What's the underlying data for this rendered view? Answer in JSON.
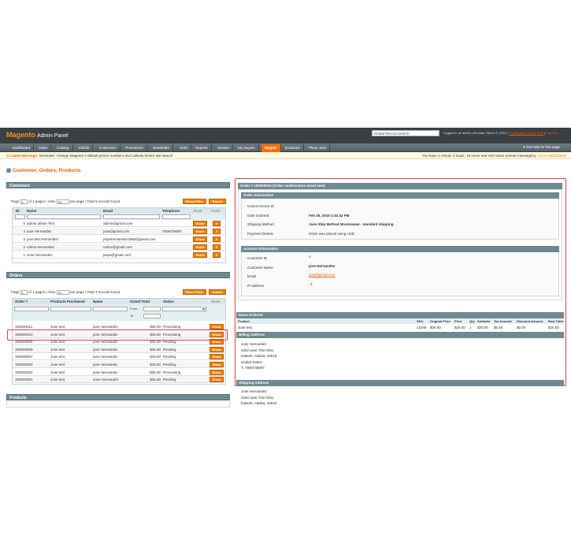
{
  "header": {
    "logo_brand": "Magento",
    "logo_text": "Admin Panel",
    "global_search_value": "Global Record Search",
    "user_info": "Logged in as admin  |  Monday, March 9, 2015  |",
    "try_link": "Try Magento Go for Free",
    "logout": "Log Out"
  },
  "nav": {
    "items": [
      "Dashboard",
      "Sales",
      "Catalog",
      "Mobile",
      "Customers",
      "Promotions",
      "Newsletter",
      "CMS",
      "Reports",
      "System",
      "My plugins",
      "Magebi",
      "Evaluator",
      "Pluya Java"
    ],
    "help": "Get help for this page"
  },
  "message": {
    "label": "Latest Message:",
    "text": "Reminder: Change Magento`s default phone numbers and callouts before site launch",
    "right": "You have 1 critical, 0 major, 18 minor and 160 notice unread message(s).",
    "link": "Go to notifications"
  },
  "page_title": "Customer, Orders, Products",
  "customers": {
    "title": "Customers",
    "pager": {
      "page_label": "Page",
      "page_value": "1",
      "of_pages": "of 1 pages  |  View",
      "per_page_value": "20",
      "per_page_label": "per page  |  Total 5 records found"
    },
    "reset": "Reset Filter",
    "search": "Search",
    "columns": [
      "ID",
      "Name",
      "Email",
      "Telephone",
      "Show",
      "Order"
    ],
    "rows": [
      {
        "id": "5",
        "name": "admin admin Test",
        "email": "admin@gmail.com",
        "tel": "",
        "show": "Show",
        "order": "0"
      },
      {
        "id": "4",
        "name": "jose Hernandez",
        "email": "jose@gmail.com",
        "tel": "7808736697",
        "show": "Show",
        "order": "7"
      },
      {
        "id": "3",
        "name": "jose test Hernandez",
        "email": "pepehernandez1980@gmail.com",
        "tel": "",
        "show": "Show",
        "order": "0"
      },
      {
        "id": "2",
        "name": "carlos Hernandez",
        "email": "carlos@gmail.com",
        "tel": "",
        "show": "Show",
        "order": "0"
      },
      {
        "id": "1",
        "name": "Jose Hernandez",
        "email": "pepe@gmail.com",
        "tel": "",
        "show": "Show",
        "order": "0"
      }
    ]
  },
  "orders": {
    "title": "Orders",
    "pager": {
      "page_label": "Page",
      "page_value": "1",
      "of_pages": "of 1 pages  |  View",
      "per_page_value": "20",
      "per_page_label": "per page  |  Total 7 records found"
    },
    "reset": "Reset Filter",
    "search": "Search",
    "columns": [
      "Order #",
      "Products Purchased",
      "Name",
      "Grand Total",
      "Status",
      "Show"
    ],
    "from_label": "From:",
    "to_label": "To :",
    "rows": [
      {
        "num": "100000011",
        "prod": "Jose test",
        "name": "jose Hernandez",
        "total": "$30.00",
        "status": "Processing",
        "show": "Show"
      },
      {
        "num": "100000010",
        "prod": "Jose test",
        "name": "jose Hernandez",
        "total": "$45.00",
        "status": "Processing",
        "show": "Show"
      },
      {
        "num": "100000008",
        "prod": "Jose test",
        "name": "jose Hernandez",
        "total": "$45.00",
        "status": "Pending",
        "show": "Show"
      },
      {
        "num": "100000009",
        "prod": "Jose test",
        "name": "jose Hernandez",
        "total": "$45.00",
        "status": "Pending",
        "show": "Show"
      },
      {
        "num": "100000007",
        "prod": "Jose test",
        "name": "jose Hernandez",
        "total": "$45.00",
        "status": "Pending",
        "show": "Show"
      },
      {
        "num": "100000003",
        "prod": "Jose test",
        "name": "jose Hernandez",
        "total": "$45.00",
        "status": "Pending",
        "show": "Show"
      },
      {
        "num": "100000002",
        "prod": "Jose test",
        "name": "jose Hernandez",
        "total": "$35.00",
        "status": "Processing",
        "show": "Show"
      },
      {
        "num": "100000001",
        "prod": "Jose test",
        "name": "Jose Hernandez",
        "total": "$45.00",
        "status": "Pending",
        "show": "Show"
      }
    ]
  },
  "products": {
    "title": "Products"
  },
  "order_detail": {
    "title": "Order # 100000010 (Order confirmation email sent)",
    "info_title": "Order Information",
    "info": [
      {
        "k": "Conns Invoice Id",
        "v": ""
      },
      {
        "k": "Date Ordered",
        "v": "Feb 25, 2015 2:33:42 PM"
      },
      {
        "k": "Shipping Method",
        "v": "Jose Ship Method Nnnnnwww - standard shipping"
      },
      {
        "k": "Payment Details",
        "v": "Order was placed using USD"
      }
    ],
    "account_title": "Account Information",
    "account": [
      {
        "k": "Customer ID",
        "v": "4"
      },
      {
        "k": "Customer Name",
        "v": "jose Hernandez"
      },
      {
        "k": "Email",
        "v": "jose@gmail.com"
      },
      {
        "k": "IP address",
        "v": "::1"
      }
    ],
    "items_title": "Items Ordered",
    "items_cols": [
      "Product",
      "SKU",
      "Original Price",
      "Price",
      "Qty",
      "Subtotal",
      "Tax Amount",
      "Discount Amount",
      "Row Total"
    ],
    "items_row": [
      "Jose test",
      "12345",
      "$20.00",
      "$20.00",
      "1",
      "$20.00",
      "$0.00",
      "$0.00",
      "$20.00"
    ],
    "billing_title": "Billing Address",
    "billing": [
      "Jose Hernandez",
      "3262 west 70st #201",
      "hialeah, Alaska, 33018",
      "United States",
      "T: 7808736697"
    ],
    "shipping_title": "Shipping Address",
    "shipping": [
      "Jose Hernandez",
      "3262 west 70st #201",
      "hialeah, Alaska, 33018"
    ]
  }
}
